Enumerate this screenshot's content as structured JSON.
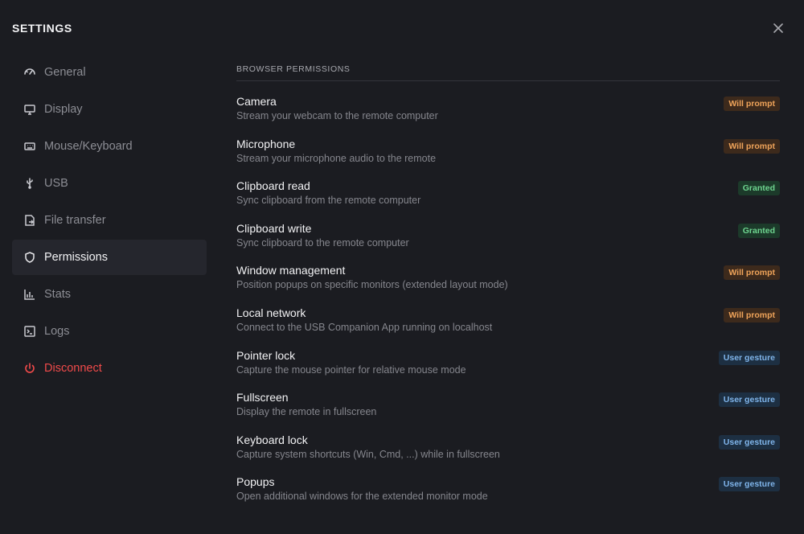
{
  "window": {
    "title": "SETTINGS",
    "close_icon": "close-icon"
  },
  "sidebar": {
    "items": [
      {
        "label": "General",
        "icon": "gauge-icon",
        "active": false
      },
      {
        "label": "Display",
        "icon": "monitor-icon",
        "active": false
      },
      {
        "label": "Mouse/Keyboard",
        "icon": "keyboard-icon",
        "active": false
      },
      {
        "label": "USB",
        "icon": "usb-icon",
        "active": false
      },
      {
        "label": "File transfer",
        "icon": "file-transfer-icon",
        "active": false
      },
      {
        "label": "Permissions",
        "icon": "shield-icon",
        "active": true
      },
      {
        "label": "Stats",
        "icon": "bar-chart-icon",
        "active": false
      },
      {
        "label": "Logs",
        "icon": "terminal-icon",
        "active": false
      },
      {
        "label": "Disconnect",
        "icon": "power-icon",
        "active": false,
        "danger": true
      }
    ]
  },
  "main": {
    "section_title": "BROWSER PERMISSIONS",
    "permissions": [
      {
        "name": "Camera",
        "description": "Stream your webcam to the remote computer",
        "status": "Will prompt"
      },
      {
        "name": "Microphone",
        "description": "Stream your microphone audio to the remote",
        "status": "Will prompt"
      },
      {
        "name": "Clipboard read",
        "description": "Sync clipboard from the remote computer",
        "status": "Granted"
      },
      {
        "name": "Clipboard write",
        "description": "Sync clipboard to the remote computer",
        "status": "Granted"
      },
      {
        "name": "Window management",
        "description": "Position popups on specific monitors (extended layout mode)",
        "status": "Will prompt"
      },
      {
        "name": "Local network",
        "description": "Connect to the USB Companion App running on localhost",
        "status": "Will prompt"
      },
      {
        "name": "Pointer lock",
        "description": "Capture the mouse pointer for relative mouse mode",
        "status": "User gesture"
      },
      {
        "name": "Fullscreen",
        "description": "Display the remote in fullscreen",
        "status": "User gesture"
      },
      {
        "name": "Keyboard lock",
        "description": "Capture system shortcuts (Win, Cmd, ...) while in fullscreen",
        "status": "User gesture"
      },
      {
        "name": "Popups",
        "description": "Open additional windows for the extended monitor mode",
        "status": "User gesture"
      }
    ]
  },
  "colors": {
    "background": "#1b1c21",
    "active_item": "#25262d",
    "danger": "#f04a4a",
    "will_prompt": "#f0a45a",
    "granted": "#6ed48f",
    "user_gesture": "#7fb4ea"
  }
}
